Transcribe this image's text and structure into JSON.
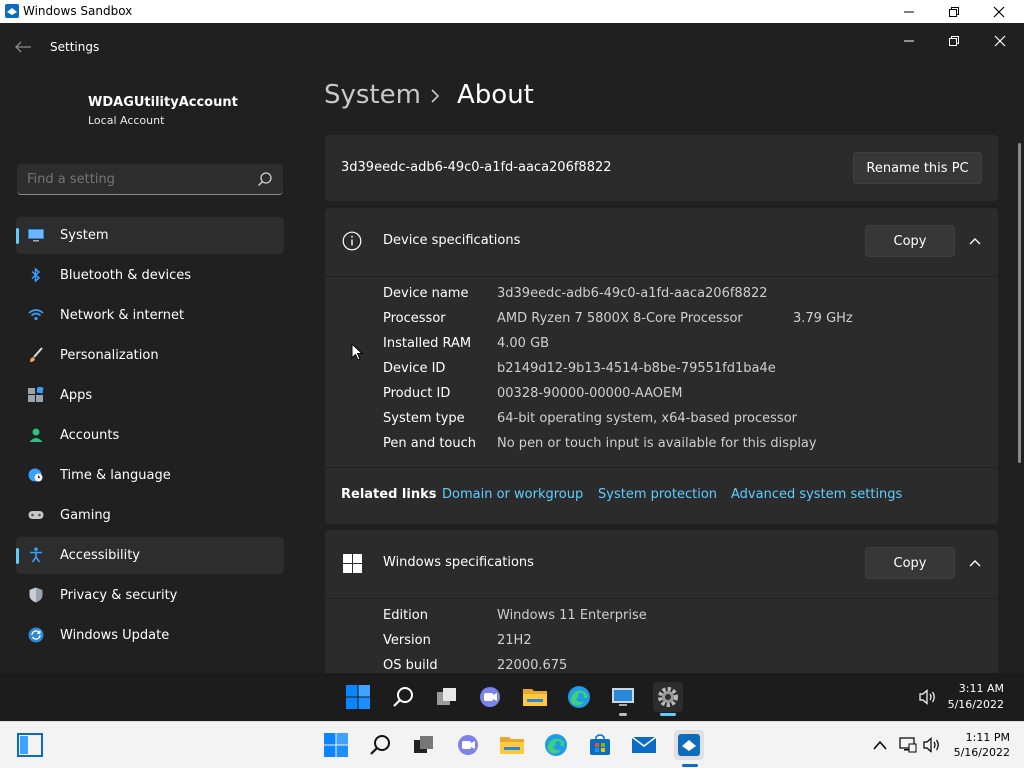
{
  "sandbox": {
    "title": "Windows Sandbox"
  },
  "settings_window": {
    "title": "Settings"
  },
  "user": {
    "name": "WDAGUtilityAccount",
    "type": "Local Account"
  },
  "search": {
    "placeholder": "Find a setting"
  },
  "nav": [
    {
      "label": "System",
      "icon": "system-icon",
      "active": true
    },
    {
      "label": "Bluetooth & devices",
      "icon": "bluetooth-icon"
    },
    {
      "label": "Network & internet",
      "icon": "wifi-icon"
    },
    {
      "label": "Personalization",
      "icon": "brush-icon"
    },
    {
      "label": "Apps",
      "icon": "apps-icon"
    },
    {
      "label": "Accounts",
      "icon": "person-icon"
    },
    {
      "label": "Time & language",
      "icon": "globe-clock-icon"
    },
    {
      "label": "Gaming",
      "icon": "controller-icon"
    },
    {
      "label": "Accessibility",
      "icon": "accessibility-icon",
      "hover": true
    },
    {
      "label": "Privacy & security",
      "icon": "shield-icon"
    },
    {
      "label": "Windows Update",
      "icon": "update-icon"
    }
  ],
  "breadcrumb": {
    "parent": "System",
    "current": "About"
  },
  "pc": {
    "name": "3d39eedc-adb6-49c0-a1fd-aaca206f8822",
    "rename_label": "Rename this PC"
  },
  "device_specs": {
    "title": "Device specifications",
    "copy_label": "Copy",
    "rows": [
      {
        "key": "Device name",
        "value": "3d39eedc-adb6-49c0-a1fd-aaca206f8822",
        "extra": ""
      },
      {
        "key": "Processor",
        "value": "AMD Ryzen 7 5800X 8-Core Processor",
        "extra": "3.79 GHz"
      },
      {
        "key": "Installed RAM",
        "value": "4.00 GB",
        "extra": ""
      },
      {
        "key": "Device ID",
        "value": "b2149d12-9b13-4514-b8be-79551fd1ba4e",
        "extra": ""
      },
      {
        "key": "Product ID",
        "value": "00328-90000-00000-AAOEM",
        "extra": ""
      },
      {
        "key": "System type",
        "value": "64-bit operating system, x64-based processor",
        "extra": ""
      },
      {
        "key": "Pen and touch",
        "value": "No pen or touch input is available for this display",
        "extra": ""
      }
    ]
  },
  "related_links": {
    "label": "Related links",
    "links": [
      "Domain or workgroup",
      "System protection",
      "Advanced system settings"
    ]
  },
  "windows_specs": {
    "title": "Windows specifications",
    "copy_label": "Copy",
    "rows": [
      {
        "key": "Edition",
        "value": "Windows 11 Enterprise"
      },
      {
        "key": "Version",
        "value": "21H2"
      },
      {
        "key": "OS build",
        "value": "22000.675"
      }
    ]
  },
  "inner_taskbar": {
    "time": "3:11 AM",
    "date": "5/16/2022"
  },
  "outer_taskbar": {
    "time": "1:11 PM",
    "date": "5/16/2022"
  },
  "colors": {
    "accent": "#60cdff",
    "background": "#202020",
    "card": "#2b2b2b"
  }
}
